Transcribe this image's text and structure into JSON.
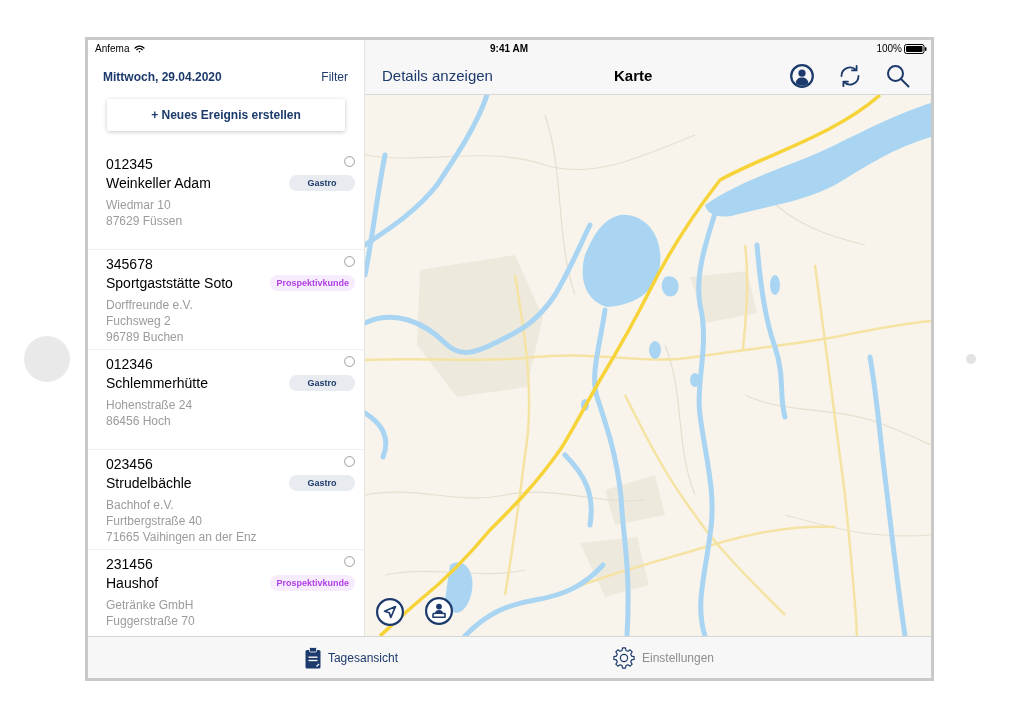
{
  "status_bar": {
    "carrier": "Anfema",
    "time": "9:41 AM",
    "battery": "100%"
  },
  "sidebar": {
    "date": "Mittwoch, 29.04.2020",
    "filter": "Filter",
    "new_event_button": "+ Neues Ereignis erstellen",
    "items": [
      {
        "number": "012345",
        "name": "Weinkeller Adam",
        "tag": {
          "label": "Gastro",
          "color": "#1c3a6b"
        },
        "address": [
          "Wiedmar 10",
          "87629 Füssen"
        ],
        "checked": false
      },
      {
        "number": "345678",
        "name": "Sportgaststätte Soto",
        "tag": {
          "label": "Prospektivkunde",
          "color": "#b13fe6"
        },
        "address": [
          "Dorffreunde e.V.",
          "Fuchsweg 2",
          "96789 Buchen"
        ],
        "checked": false
      },
      {
        "number": "012346",
        "name": "Schlemmerhütte",
        "tag": {
          "label": "Gastro",
          "color": "#1c3a6b"
        },
        "address": [
          "Hohenstraße 24",
          "86456 Hoch"
        ],
        "checked": false
      },
      {
        "number": "023456",
        "name": "Strudelbächle",
        "tag": {
          "label": "Gastro",
          "color": "#1c3a6b"
        },
        "address": [
          "Bachhof e.V.",
          "Furtbergstraße 40",
          "71665 Vaihingen an der Enz"
        ],
        "checked": false
      },
      {
        "number": "231456",
        "name": "Haushof",
        "tag": {
          "label": "Prospektivkunde",
          "color": "#b13fe6"
        },
        "address": [
          "Getränke GmbH",
          "Fuggerstraße 70"
        ],
        "checked": false
      }
    ]
  },
  "map_view": {
    "back_link": "Details anzeigen",
    "title": "Karte"
  },
  "tab_bar": {
    "tabs": [
      {
        "label": "Tagesansicht",
        "selected": true
      },
      {
        "label": "Einstellungen",
        "selected": false
      }
    ]
  }
}
